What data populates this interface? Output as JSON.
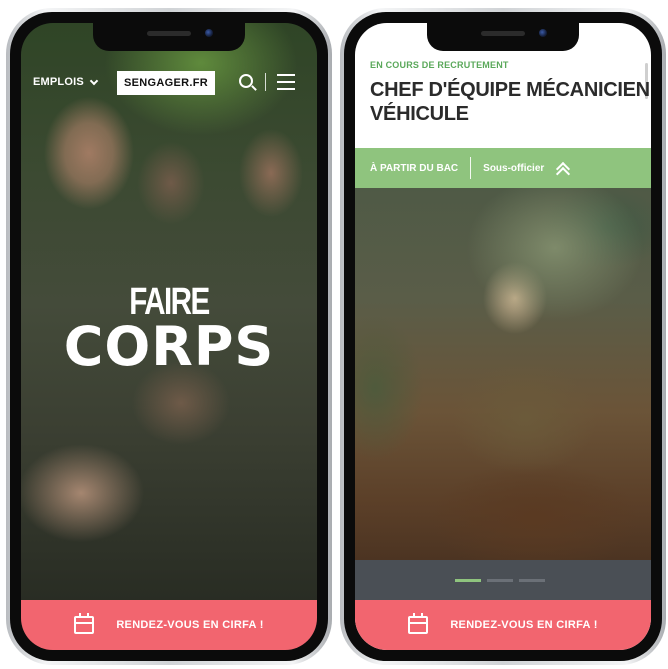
{
  "left": {
    "nav": {
      "emplois_label": "EMPLOIS",
      "logo_text": "SENGAGER.FR",
      "search_icon": "search-icon",
      "menu_icon": "hamburger-icon"
    },
    "hero": {
      "line1": "FAIRE",
      "line2": "CORPS"
    },
    "cta": {
      "label": "RENDEZ-VOUS EN CIRFA !",
      "icon": "calendar-icon"
    }
  },
  "right": {
    "status": "EN COURS DE RECRUTEMENT",
    "title_line1": "CHEF D'ÉQUIPE MÉCANICIEN",
    "title_line2": "VÉHICULE",
    "level": "À PARTIR DU BAC",
    "rank": "Sous-officier",
    "carousel": {
      "active_index": 0,
      "count": 3
    },
    "cta": {
      "label": "RENDEZ-VOUS EN CIRFA !",
      "icon": "calendar-icon"
    }
  },
  "colors": {
    "cta": "#f2656f",
    "accent_green": "#8fc47e",
    "status_green": "#5aa85a",
    "title": "#2b2b2b"
  }
}
